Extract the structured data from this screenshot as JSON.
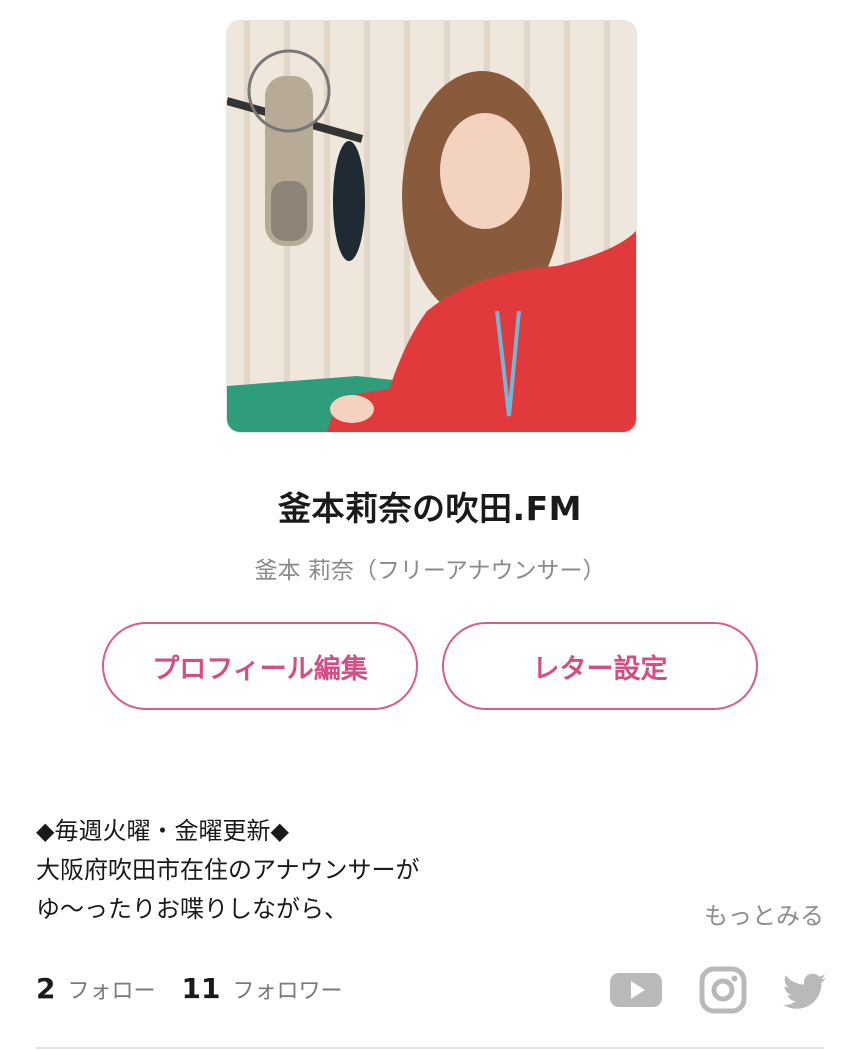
{
  "program": {
    "title": "釜本莉奈の吹田.FM",
    "host": "釜本 莉奈（フリーアナウンサー）"
  },
  "actions": {
    "edit_profile": "プロフィール編集",
    "letter_settings": "レター設定"
  },
  "description": {
    "lines": [
      "◆毎週火曜・金曜更新◆",
      "大阪府吹田市在住のアナウンサーが",
      "ゆ〜ったりお喋りしながら、"
    ],
    "more": "もっとみる"
  },
  "stats": {
    "following_count": "2",
    "following_label": "フォロー",
    "followers_count": "11",
    "followers_label": "フォロワー"
  },
  "social": [
    "youtube-icon",
    "instagram-icon",
    "twitter-icon"
  ],
  "colors": {
    "accent": "#d85b8d",
    "social_icon": "#b9b9b9"
  }
}
